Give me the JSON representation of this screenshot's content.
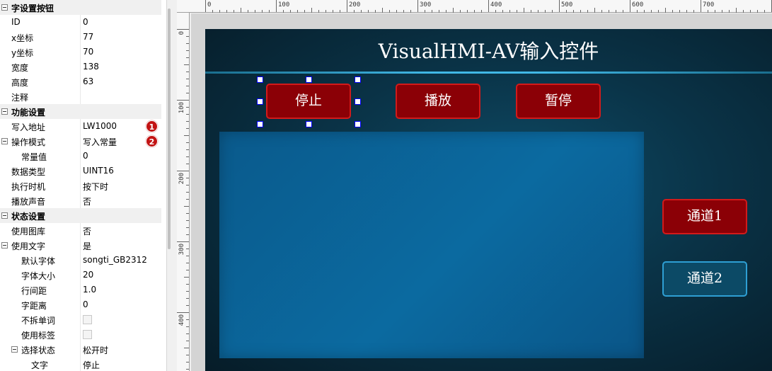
{
  "props": {
    "rows": [
      {
        "kind": "section",
        "label": "字设置按钮"
      },
      {
        "kind": "row",
        "label": "ID",
        "value": "0"
      },
      {
        "kind": "row",
        "label": "x坐标",
        "value": "77"
      },
      {
        "kind": "row",
        "label": "y坐标",
        "value": "70"
      },
      {
        "kind": "row",
        "label": "宽度",
        "value": "138"
      },
      {
        "kind": "row",
        "label": "高度",
        "value": "63"
      },
      {
        "kind": "row",
        "label": "注释",
        "value": ""
      },
      {
        "kind": "section",
        "label": "功能设置"
      },
      {
        "kind": "row",
        "label": "写入地址",
        "value": "LW1000",
        "badge": "1"
      },
      {
        "kind": "row",
        "label": "操作模式",
        "value": "写入常量",
        "badge": "2",
        "toggle": true
      },
      {
        "kind": "row",
        "label": "常量值",
        "value": "0",
        "indent": 1
      },
      {
        "kind": "row",
        "label": "数据类型",
        "value": "UINT16"
      },
      {
        "kind": "row",
        "label": "执行时机",
        "value": "按下时"
      },
      {
        "kind": "row",
        "label": "播放声音",
        "value": "否"
      },
      {
        "kind": "section",
        "label": "状态设置"
      },
      {
        "kind": "row",
        "label": "使用图库",
        "value": "否"
      },
      {
        "kind": "row",
        "label": "使用文字",
        "value": "是",
        "toggle": true
      },
      {
        "kind": "row",
        "label": "默认字体",
        "value": "songti_GB2312",
        "indent": 1
      },
      {
        "kind": "row",
        "label": "字体大小",
        "value": "20",
        "indent": 1
      },
      {
        "kind": "row",
        "label": "行间距",
        "value": "1.0",
        "indent": 1
      },
      {
        "kind": "row",
        "label": "字距离",
        "value": "0",
        "indent": 1
      },
      {
        "kind": "row",
        "label": "不拆单词",
        "value": "",
        "checkbox": true,
        "indent": 1
      },
      {
        "kind": "row",
        "label": "使用标签",
        "value": "",
        "checkbox": true,
        "indent": 1
      },
      {
        "kind": "row",
        "label": "选择状态",
        "value": "松开时",
        "toggle": true,
        "indent": 1
      },
      {
        "kind": "row",
        "label": "文字",
        "value": "停止",
        "indent": 2
      }
    ]
  },
  "ruler": {
    "h_labels": [
      "0",
      "100",
      "200",
      "300",
      "400",
      "500",
      "600",
      "700"
    ],
    "v_labels": [
      "0",
      "100",
      "200",
      "300",
      "400"
    ]
  },
  "screen": {
    "title": "VisualHMI-AV输入控件",
    "buttons": {
      "stop": "停止",
      "play": "播放",
      "pause": "暂停",
      "channel1": "通道1",
      "channel2": "通道2"
    }
  },
  "colors": {
    "button_red": "#8b0006",
    "button_red_border": "#d21a1a",
    "button_blue": "#0c4a66",
    "button_blue_border": "#2e9fd4",
    "title_line": "#41b8e6",
    "video_fill": "#0b6aa0"
  }
}
